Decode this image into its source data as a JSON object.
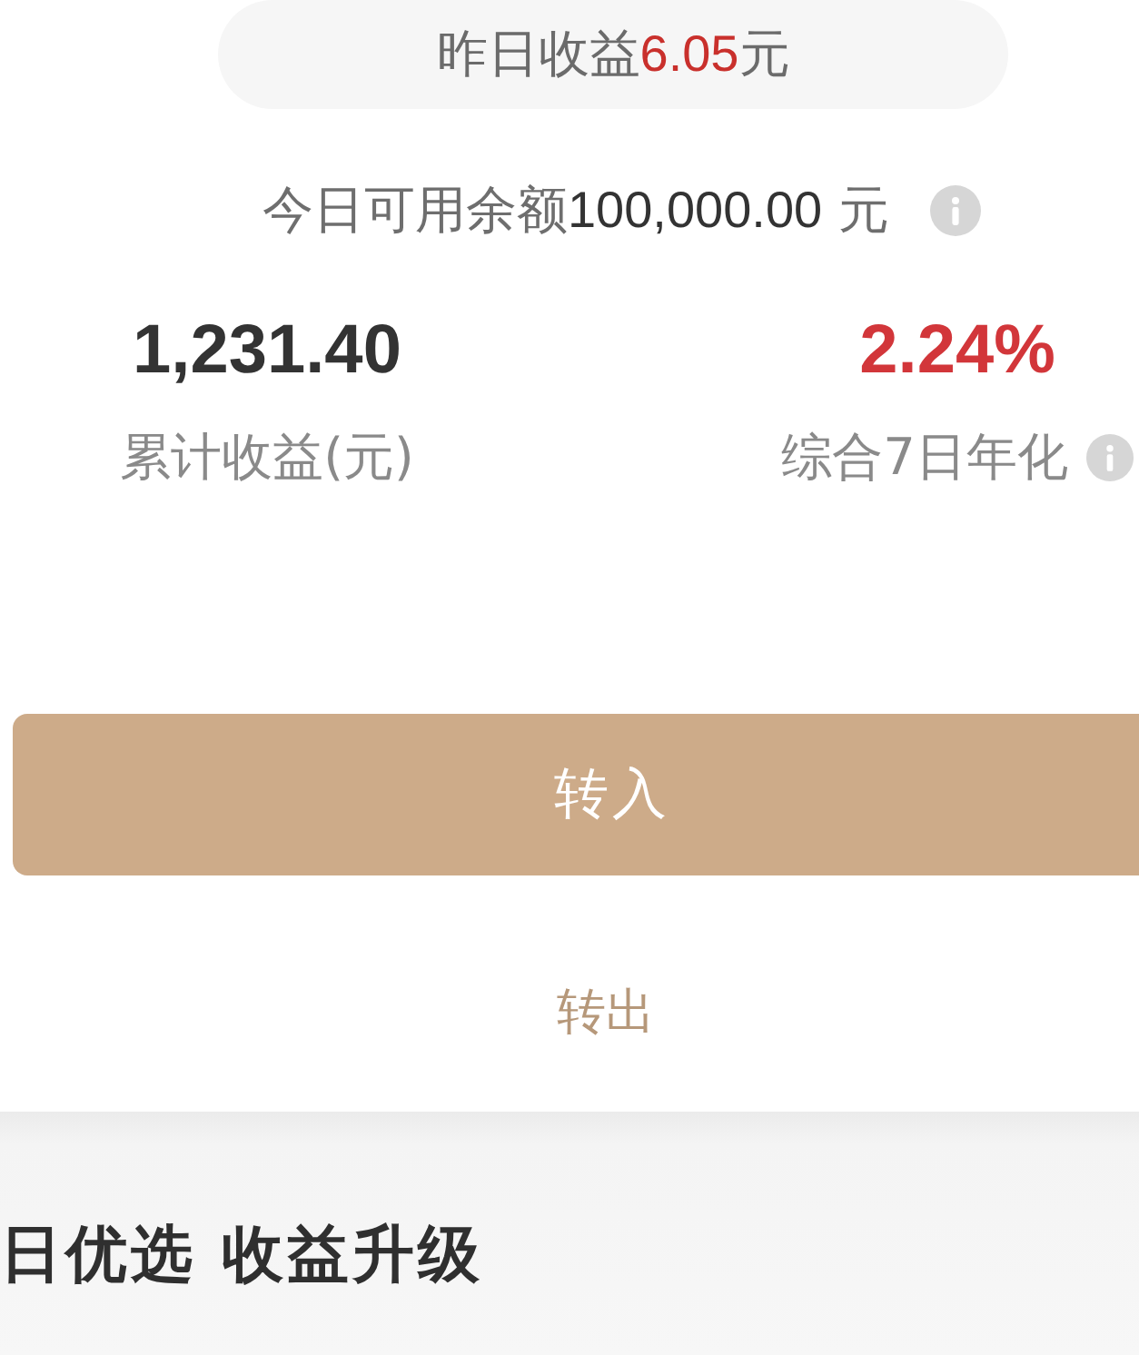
{
  "yesterday_earnings": {
    "label": "昨日收益",
    "amount": "6.05",
    "unit": "元"
  },
  "available_balance": {
    "label": "今日可用余额",
    "amount": "100,000.00",
    "unit": " 元",
    "info": true
  },
  "stats": [
    {
      "value": "1,231.40",
      "label": "累计收益(元)",
      "highlight": false,
      "info": false
    },
    {
      "value": "2.24%",
      "label": "综合7日年化",
      "highlight": true,
      "info": true
    }
  ],
  "buttons": [
    {
      "label": "转入",
      "kind": "primary"
    },
    {
      "label": "转出",
      "kind": "link"
    }
  ],
  "section": {
    "title": "日优选 收益升级"
  }
}
